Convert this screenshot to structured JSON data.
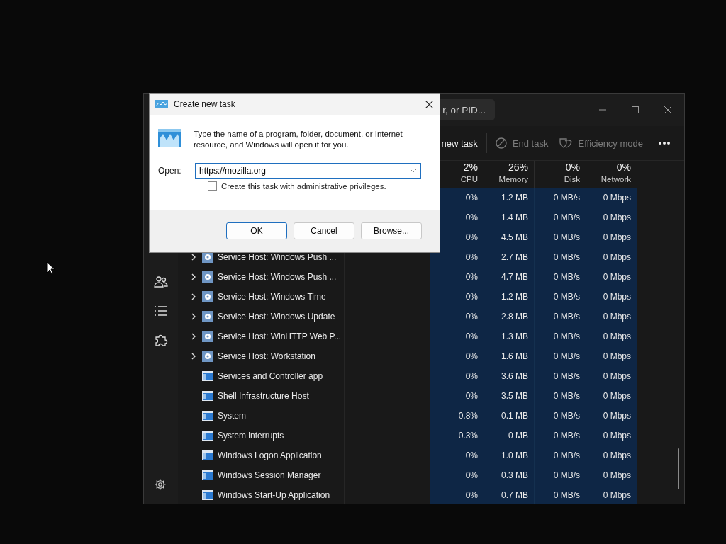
{
  "task_manager": {
    "search": {
      "placeholder": "r, or PID..."
    },
    "toolbar": [
      {
        "label": "new task",
        "disabled": false,
        "kind": "new"
      },
      {
        "label": "End task",
        "disabled": true,
        "kind": "end"
      },
      {
        "label": "Efficiency mode",
        "disabled": true,
        "kind": "efficiency"
      }
    ],
    "columns": [
      {
        "percent": "2%",
        "label": "CPU"
      },
      {
        "percent": "26%",
        "label": "Memory"
      },
      {
        "percent": "0%",
        "label": "Disk"
      },
      {
        "percent": "0%",
        "label": "Network"
      }
    ],
    "rows": [
      {
        "cpu": "0%",
        "memory": "1.2 MB",
        "disk": "0 MB/s",
        "network": "0 Mbps"
      },
      {
        "cpu": "0%",
        "memory": "1.4 MB",
        "disk": "0 MB/s",
        "network": "0 Mbps"
      },
      {
        "cpu": "0%",
        "memory": "4.5 MB",
        "disk": "0 MB/s",
        "network": "0 Mbps"
      },
      {
        "name": "Service Host: Windows Push ...",
        "kind": "service",
        "expanded": false,
        "cpu": "0%",
        "memory": "2.7 MB",
        "disk": "0 MB/s",
        "network": "0 Mbps"
      },
      {
        "name": "Service Host: Windows Push ...",
        "kind": "service",
        "expanded": false,
        "cpu": "0%",
        "memory": "4.7 MB",
        "disk": "0 MB/s",
        "network": "0 Mbps"
      },
      {
        "name": "Service Host: Windows Time",
        "kind": "service",
        "expanded": false,
        "cpu": "0%",
        "memory": "1.2 MB",
        "disk": "0 MB/s",
        "network": "0 Mbps"
      },
      {
        "name": "Service Host: Windows Update",
        "kind": "service",
        "expanded": false,
        "cpu": "0%",
        "memory": "2.8 MB",
        "disk": "0 MB/s",
        "network": "0 Mbps"
      },
      {
        "name": "Service Host: WinHTTP Web P...",
        "kind": "service",
        "expanded": false,
        "cpu": "0%",
        "memory": "1.3 MB",
        "disk": "0 MB/s",
        "network": "0 Mbps"
      },
      {
        "name": "Service Host: Workstation",
        "kind": "service",
        "expanded": false,
        "cpu": "0%",
        "memory": "1.6 MB",
        "disk": "0 MB/s",
        "network": "0 Mbps"
      },
      {
        "name": "Services and Controller app",
        "kind": "app",
        "cpu": "0%",
        "memory": "3.6 MB",
        "disk": "0 MB/s",
        "network": "0 Mbps"
      },
      {
        "name": "Shell Infrastructure Host",
        "kind": "app",
        "cpu": "0%",
        "memory": "3.5 MB",
        "disk": "0 MB/s",
        "network": "0 Mbps"
      },
      {
        "name": "System",
        "kind": "app",
        "cpu": "0.8%",
        "memory": "0.1 MB",
        "disk": "0 MB/s",
        "network": "0 Mbps"
      },
      {
        "name": "System interrupts",
        "kind": "app",
        "cpu": "0.3%",
        "memory": "0 MB",
        "disk": "0 MB/s",
        "network": "0 Mbps"
      },
      {
        "name": "Windows Logon Application",
        "kind": "app",
        "cpu": "0%",
        "memory": "1.0 MB",
        "disk": "0 MB/s",
        "network": "0 Mbps"
      },
      {
        "name": "Windows Session Manager",
        "kind": "app",
        "cpu": "0%",
        "memory": "0.3 MB",
        "disk": "0 MB/s",
        "network": "0 Mbps"
      },
      {
        "name": "Windows Start-Up Application",
        "kind": "app",
        "cpu": "0%",
        "memory": "0.7 MB",
        "disk": "0 MB/s",
        "network": "0 Mbps"
      }
    ]
  },
  "dialog": {
    "title": "Create new task",
    "message": "Type the name of a program, folder, document, or Internet resource, and Windows will open it for you.",
    "open_label": "Open:",
    "value": "https://mozilla.org",
    "checkbox": {
      "label": "Create this task with administrative privileges.",
      "checked": false
    },
    "buttons": [
      {
        "label": "OK",
        "default": true
      },
      {
        "label": "Cancel",
        "default": false
      },
      {
        "label": "Browse...",
        "default": false
      }
    ]
  }
}
